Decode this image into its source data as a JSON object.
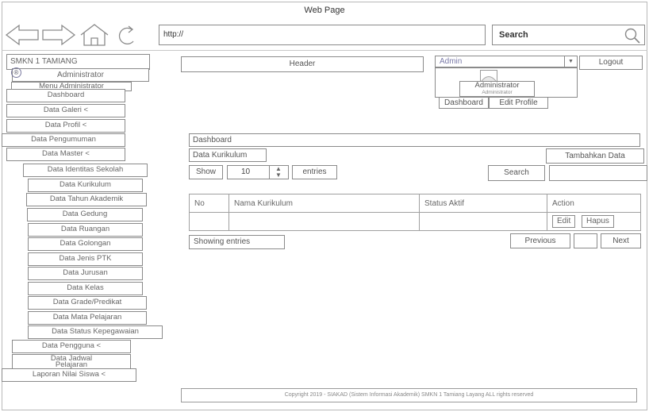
{
  "window": {
    "title": "Web Page"
  },
  "browser": {
    "url": "http://",
    "search_label": "Search"
  },
  "sidebar": {
    "school": "SMKN 1 TAMIANG",
    "admin_label": "Administrator",
    "admin_badge": "®",
    "menu_title": "Menu Administrator",
    "items": [
      "Dashboard",
      "Data Galeri <",
      "Data Profil <",
      "Data Pengumuman",
      "Data Master <",
      "Data Identitas Sekolah",
      "Data Kurikulum",
      "Data Tahun Akademik",
      "Data Gedung",
      "Data Ruangan",
      "Data Golongan",
      "Data Jenis PTK",
      "Data Jurusan",
      "Data Kelas",
      "Data Grade/Predikat",
      "Data Mata Pelajaran",
      "Data Status Kepegawaian",
      "Data Pengguna <",
      "Data Jadwal Pelajaran",
      "Laporan Nilai Siswa <"
    ]
  },
  "header": {
    "label": "Header"
  },
  "user_panel": {
    "select_value": "Admin",
    "logout_label": "Logout",
    "name": "Administrator",
    "role": "Administrator",
    "dashboard_btn": "Dashboard",
    "edit_profile_btn": "Edit Profile"
  },
  "content": {
    "breadcrumb": "Dashboard",
    "section_title": "Data Kurikulum",
    "add_button": "Tambahkan Data",
    "show_label": "Show",
    "show_value": "10",
    "entries_label": "entries",
    "search_label": "Search",
    "table": {
      "headers": [
        "No",
        "Nama Kurikulum",
        "Status Aktif",
        "Action"
      ],
      "edit_label": "Edit",
      "delete_label": "Hapus"
    },
    "showing_entries": "Showing entries",
    "prev_label": "Previous",
    "next_label": "Next"
  },
  "footer": {
    "text": "Copyright 2019 - SIAKAD (Sistem Informasi Akademik) SMKN 1 Tamiang Layang ALL rights reserved"
  }
}
